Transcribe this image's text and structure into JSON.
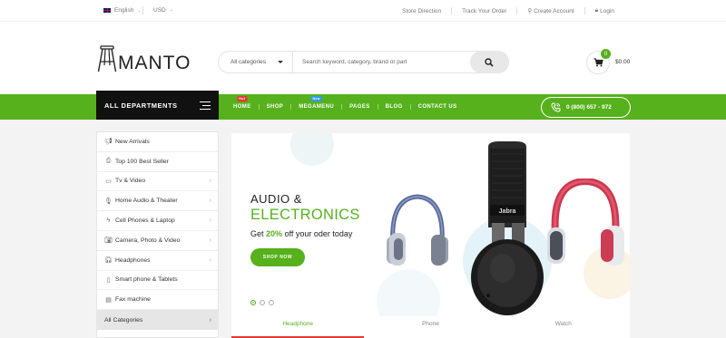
{
  "topbar": {
    "language": "English",
    "currency": "USD",
    "links": [
      "Store Direction",
      "Track Your Order",
      "Create Account",
      "Login"
    ]
  },
  "header": {
    "logo_text": "MANTO",
    "search": {
      "category": "All categories",
      "placeholder": "Search keyword, category, brand or part"
    },
    "cart": {
      "count": "0",
      "total": "$0.00"
    }
  },
  "nav": {
    "departments_label": "ALL DEPARTMENTS",
    "items": [
      {
        "label": "HOME",
        "tag": "Hot"
      },
      {
        "label": "SHOP",
        "tag": ""
      },
      {
        "label": "MEGAMENU",
        "tag": "New"
      },
      {
        "label": "PAGES",
        "tag": ""
      },
      {
        "label": "BLOG",
        "tag": ""
      },
      {
        "label": "CONTACT US",
        "tag": ""
      }
    ],
    "phone": "0 (800) 657 - 972"
  },
  "sidebar": {
    "items": [
      {
        "label": "New Arrivals",
        "icon": "megaphone-icon",
        "arrow": false
      },
      {
        "label": "Top 100 Best Seller",
        "icon": "printer-icon",
        "arrow": false
      },
      {
        "label": "Tv & Video",
        "icon": "monitor-icon",
        "arrow": true
      },
      {
        "label": "Home Audio & Theater",
        "icon": "microphone-icon",
        "arrow": true
      },
      {
        "label": "Cell Phones & Laptop",
        "icon": "bolt-icon",
        "arrow": true
      },
      {
        "label": "Camera, Photo & Video",
        "icon": "camera-icon",
        "arrow": true
      },
      {
        "label": "Headphones",
        "icon": "headphones-icon",
        "arrow": true
      },
      {
        "label": "Smart phone & Tablets",
        "icon": "phone-icon",
        "arrow": false
      },
      {
        "label": "Fax machine",
        "icon": "fax-icon",
        "arrow": false
      }
    ],
    "all_label": "All Categories"
  },
  "banner": {
    "line1": "AUDIO &",
    "line2": "ELECTRONICS",
    "line3_prefix": "Get ",
    "line3_highlight": "20%",
    "line3_suffix": " off your oder today",
    "cta": "SHOP NOW",
    "brand_on_product": "Jabra",
    "slides": 3,
    "active_slide": 1
  },
  "tabs": [
    {
      "label": "Headphone",
      "active": true
    },
    {
      "label": "Phone",
      "active": false
    },
    {
      "label": "Watch",
      "active": false
    }
  ],
  "colors": {
    "accent": "#56b11c",
    "dark": "#111111",
    "hot": "#e53935",
    "new": "#2f9be8"
  }
}
